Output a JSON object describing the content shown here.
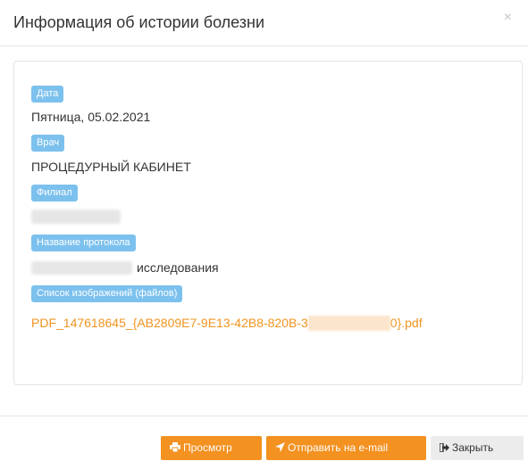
{
  "modal": {
    "title": "Информация об истории болезни",
    "close_icon": "×"
  },
  "fields": {
    "date": {
      "label": "Дата",
      "value": "Пятница, 05.02.2021"
    },
    "doctor": {
      "label": "Врач",
      "value": "ПРОЦЕДУРНЫЙ КАБИНЕТ"
    },
    "branch": {
      "label": "Филиал",
      "value": ""
    },
    "protocol": {
      "label": "Название протокола",
      "value_suffix": "исследования"
    },
    "files": {
      "label": "Список изображений (файлов)",
      "link_start": "PDF_147618645_{AB2809E7-9E13-42B8-820B-3",
      "link_end": "0}.pdf"
    }
  },
  "buttons": {
    "view": {
      "label": "Просмотр",
      "icon": "print-icon"
    },
    "email": {
      "label": "Отправить на e-mail",
      "icon": "send-icon"
    },
    "close": {
      "label": "Закрыть",
      "icon": "sign-out-icon"
    }
  },
  "colors": {
    "label_badge": "#7cc1ee",
    "accent_orange": "#f39121",
    "link_orange": "#f0941f"
  }
}
